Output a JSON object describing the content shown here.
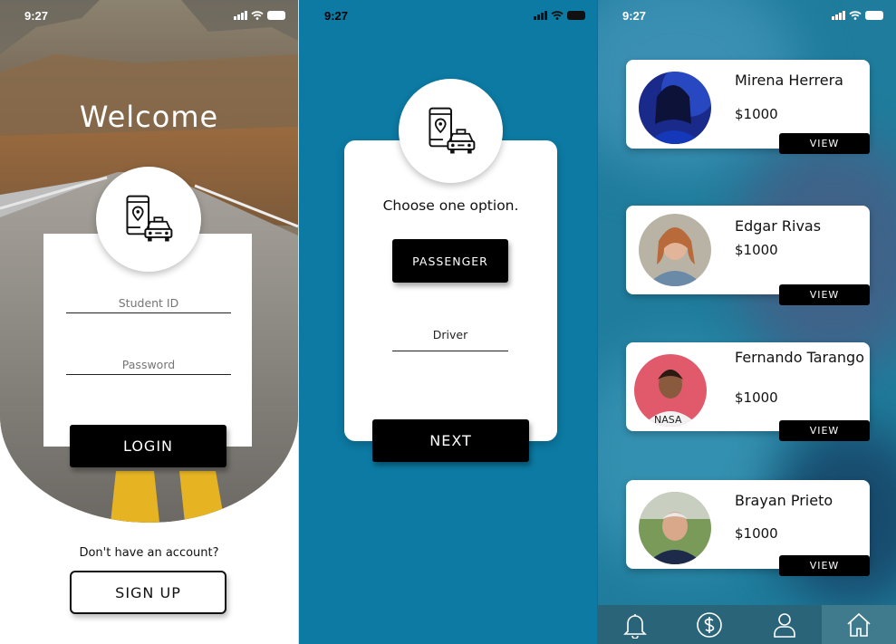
{
  "status_bar": {
    "time": "9:27"
  },
  "login_screen": {
    "title": "Welcome",
    "student_id_placeholder": "Student ID",
    "password_placeholder": "Password",
    "login_label": "LOGIN",
    "no_account_text": "Don't have an account?",
    "signup_label": "SIGN UP",
    "logo_icon": "phone-taxi-icon"
  },
  "role_screen": {
    "prompt": "Choose one option.",
    "passenger_label": "PASSENGER",
    "driver_label": "Driver",
    "next_label": "NEXT",
    "logo_icon": "phone-taxi-icon"
  },
  "drivers_screen": {
    "view_label": "VIEW",
    "drivers": [
      {
        "name": "Mirena Herrera",
        "price": "$1000"
      },
      {
        "name": "Edgar Rivas",
        "price": "$1000"
      },
      {
        "name": "Fernando Tarango",
        "price": "$1000"
      },
      {
        "name": "Brayan Prieto",
        "price": "$1000"
      }
    ],
    "nav": [
      {
        "icon": "bell-icon"
      },
      {
        "icon": "dollar-icon"
      },
      {
        "icon": "user-icon"
      },
      {
        "icon": "home-icon",
        "active": true
      }
    ]
  },
  "colors": {
    "primary_blue": "#0c7aa3",
    "button_dark": "#000000",
    "nav_bar": "#2a6478"
  }
}
